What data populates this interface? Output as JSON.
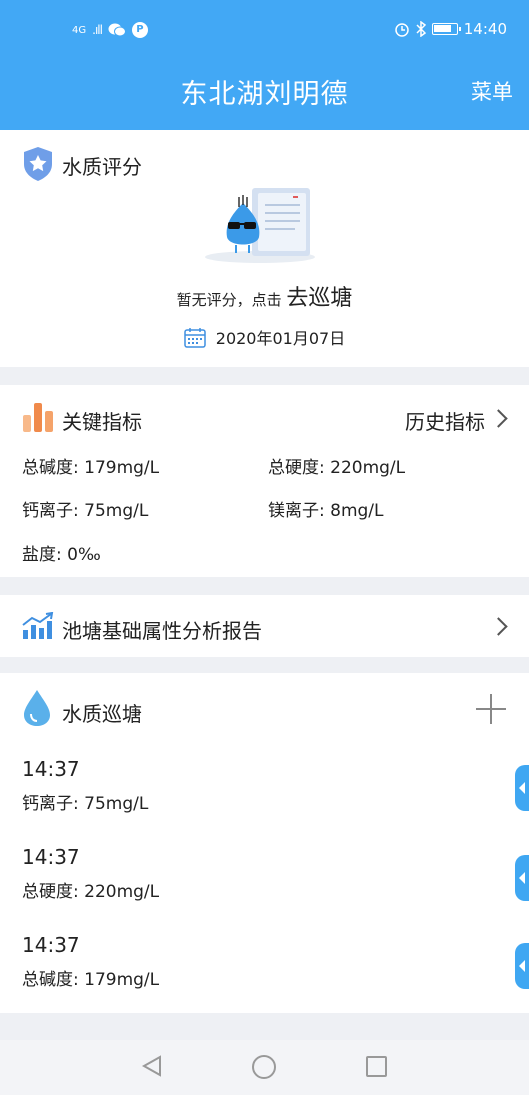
{
  "statusbar": {
    "network": "4G",
    "signal": ".ıll",
    "wechat_icon": "wechat-icon",
    "parking_badge": "P",
    "alarm_icon": "alarm-icon",
    "bluetooth_icon": "bluetooth-icon",
    "time": "14:40"
  },
  "nav": {
    "title": "东北湖刘明德",
    "menu_label": "菜单"
  },
  "score": {
    "title": "水质评分",
    "text": "暂无评分，点击",
    "action": "去巡塘",
    "date": "2020年01月07日"
  },
  "key_metrics": {
    "title": "关键指标",
    "history_link": "历史指标",
    "items": [
      "总碱度: 179mg/L",
      "总硬度: 220mg/L",
      "钙离子: 75mg/L",
      "镁离子: 8mg/L",
      "盐度: 0‰"
    ]
  },
  "report": {
    "title": "池塘基础属性分析报告"
  },
  "patrol": {
    "title": "水质巡塘",
    "records": [
      {
        "time": "14:37",
        "value": "钙离子: 75mg/L"
      },
      {
        "time": "14:37",
        "value": "总硬度: 220mg/L"
      },
      {
        "time": "14:37",
        "value": "总碱度: 179mg/L"
      }
    ]
  },
  "colors": {
    "primary": "#42a8f5",
    "icon_orange": "#f5a36a",
    "background": "#eef0f4"
  }
}
